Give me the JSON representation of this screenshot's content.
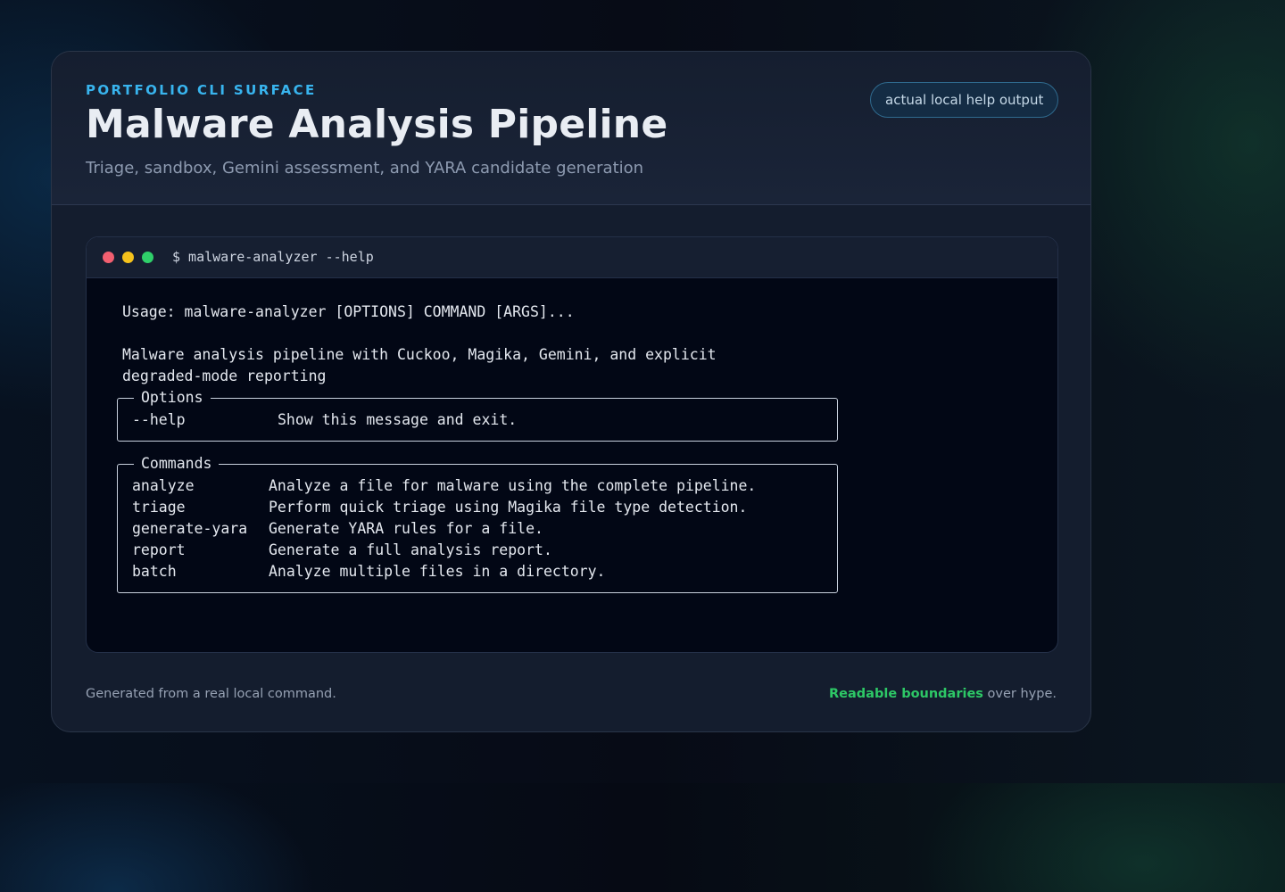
{
  "header": {
    "eyebrow": "PORTFOLIO CLI SURFACE",
    "title": "Malware Analysis Pipeline",
    "subtitle": "Triage, sandbox, Gemini assessment, and YARA candidate generation",
    "badge": "actual local help output"
  },
  "terminal": {
    "command": "$ malware-analyzer --help",
    "usage": "Usage: malware-analyzer [OPTIONS] COMMAND [ARGS]...",
    "description_lines": [
      "Malware analysis pipeline with Cuckoo, Magika, Gemini, and explicit",
      "degraded-mode reporting"
    ],
    "options": {
      "title": "Options",
      "rows": [
        {
          "name": "--help",
          "desc": "Show this message and exit."
        }
      ]
    },
    "commands": {
      "title": "Commands",
      "rows": [
        {
          "name": "analyze",
          "desc": "Analyze a file for malware using the complete pipeline."
        },
        {
          "name": "triage",
          "desc": "Perform quick triage using Magika file type detection."
        },
        {
          "name": "generate-yara",
          "desc": "Generate YARA rules for a file."
        },
        {
          "name": "report",
          "desc": "Generate a full analysis report."
        },
        {
          "name": "batch",
          "desc": "Analyze multiple files in a directory."
        }
      ]
    }
  },
  "footer": {
    "left": "Generated from a real local command.",
    "right_highlight": "Readable boundaries",
    "right_rest": " over hype."
  },
  "colors": {
    "accent_blue": "#38b4ee",
    "accent_green": "#2dc866",
    "dot_red": "#f25f70",
    "dot_yellow": "#f5c21c",
    "dot_green": "#2fd06a"
  }
}
